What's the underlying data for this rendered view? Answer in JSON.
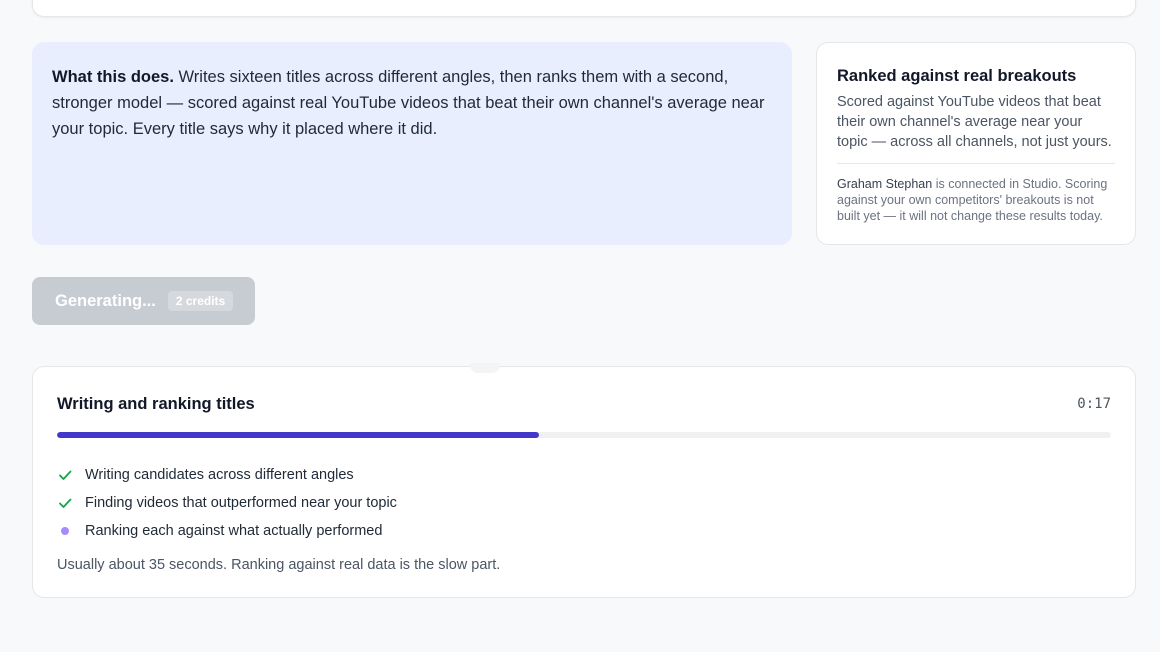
{
  "info": {
    "lead": "What this does.",
    "body": "Writes sixteen titles across different angles, then ranks them with a second, stronger model — scored against real YouTube videos that beat their own channel's average near your topic. Every title says why it placed where it did."
  },
  "side": {
    "title": "Ranked against real breakouts",
    "description": "Scored against YouTube videos that beat their own channel's average near your topic — across all channels, not just yours.",
    "channel_name": "Graham Stephan",
    "note": "is connected in Studio. Scoring against your own competitors' breakouts is not built yet — it will not change these results today."
  },
  "generate_button": {
    "label": "Generating...",
    "credits": "2 credits"
  },
  "progress": {
    "title": "Writing and ranking titles",
    "elapsed": "0:17",
    "fraction": 0.457,
    "accent": "#4338ca",
    "steps": [
      {
        "label": "Writing candidates across different angles",
        "status": "done",
        "icon": "check-icon"
      },
      {
        "label": "Finding videos that outperformed near your topic",
        "status": "done",
        "icon": "check-icon"
      },
      {
        "label": "Ranking each against what actually performed",
        "status": "active",
        "icon": "active-dot-icon"
      }
    ],
    "hint": "Usually about 35 seconds. Ranking against real data is the slow part."
  },
  "colors": {
    "check": "#16a34a",
    "active_dot": "#a78bfa",
    "info_bg": "#e8eefe"
  }
}
